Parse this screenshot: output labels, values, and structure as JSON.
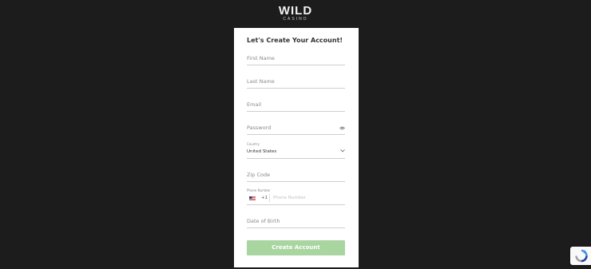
{
  "brand": {
    "name": "WILD",
    "tagline": "CASINO"
  },
  "form": {
    "title": "Let's Create Your Account!",
    "first_name": {
      "placeholder": "First Name"
    },
    "last_name": {
      "placeholder": "Last Name"
    },
    "email": {
      "placeholder": "Email"
    },
    "password": {
      "placeholder": "Password"
    },
    "country": {
      "label": "Country",
      "value": "United States"
    },
    "zip": {
      "placeholder": "Zip Code"
    },
    "phone": {
      "label": "Phone Number",
      "dial_code": "+1",
      "placeholder": "Phone Number"
    },
    "dob": {
      "placeholder": "Date of Birth"
    },
    "submit_label": "Create Account"
  },
  "colors": {
    "background": "#1c1c1c",
    "card": "#ffffff",
    "button": "#a8d5a0"
  },
  "icons": [
    "eye-icon",
    "chevron-down-icon",
    "us-flag-icon",
    "recaptcha-icon"
  ]
}
